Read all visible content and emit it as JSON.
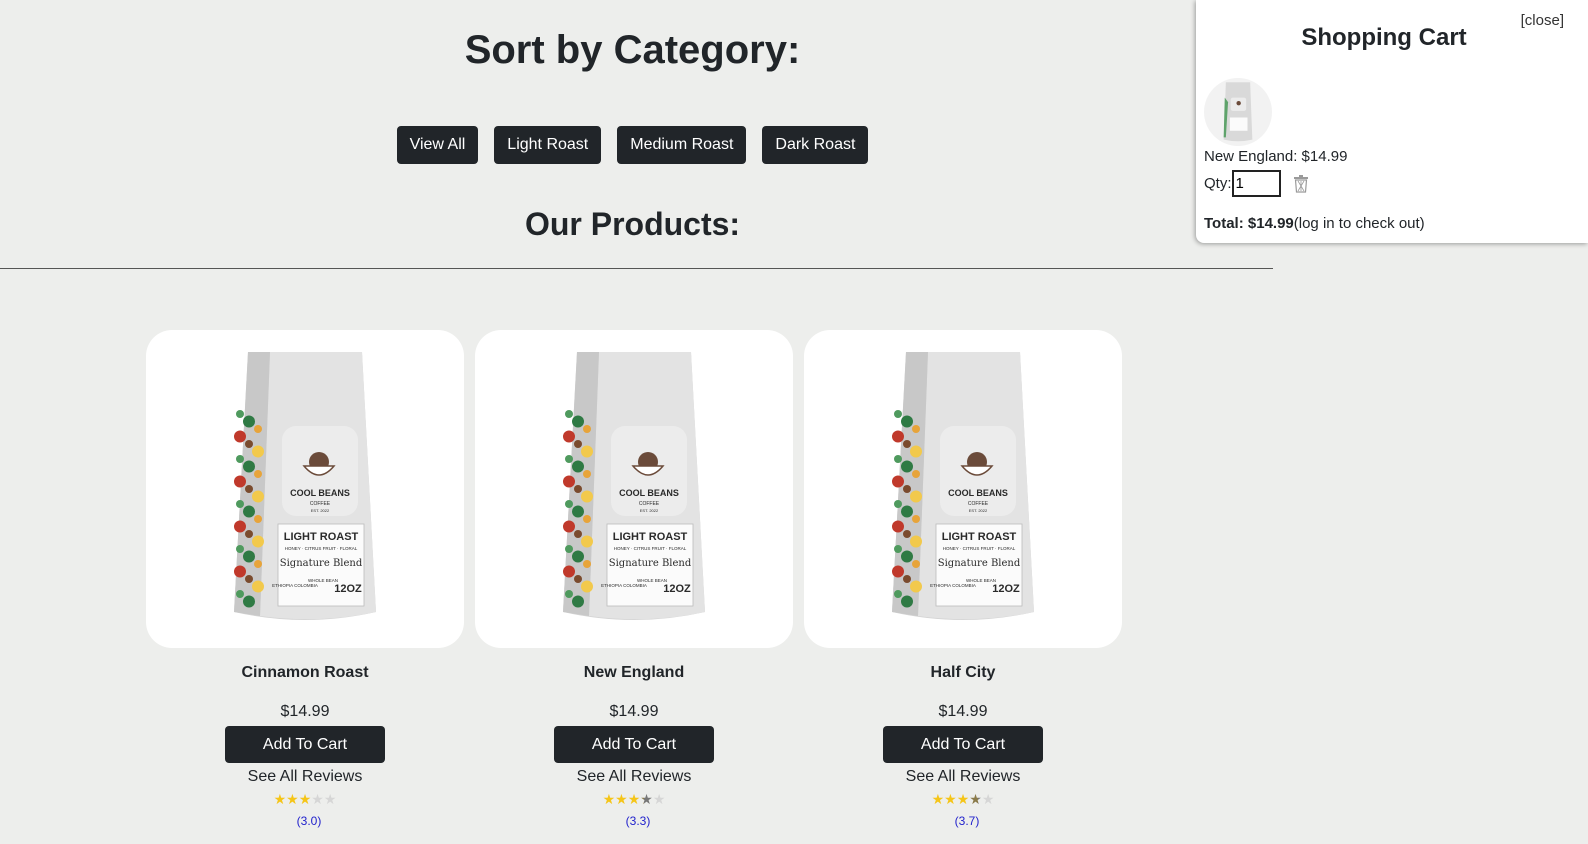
{
  "sort": {
    "heading": "Sort by Category:",
    "categories": [
      "View All",
      "Light Roast",
      "Medium Roast",
      "Dark Roast"
    ]
  },
  "products_heading": "Our Products:",
  "product_bag": {
    "brand": "COOL BEANS",
    "brand_sub": "COFFEE",
    "est": "EST. 2022",
    "roast": "LIGHT ROAST",
    "notes": "HONEY · CITRUS FRUIT · FLORAL",
    "blend": "Signature Blend",
    "origin": "ETHIOPIA COLOMBIA",
    "type": "WHOLE BEAN",
    "weight": "12OZ"
  },
  "products": [
    {
      "name": "Cinnamon Roast",
      "price": "$14.99",
      "add_label": "Add To Cart",
      "reviews_label": "See All Reviews",
      "rating": 3.0,
      "rating_text": "(3.0)"
    },
    {
      "name": "New England",
      "price": "$14.99",
      "add_label": "Add To Cart",
      "reviews_label": "See All Reviews",
      "rating": 3.3,
      "rating_text": "(3.3)"
    },
    {
      "name": "Half City",
      "price": "$14.99",
      "add_label": "Add To Cart",
      "reviews_label": "See All Reviews",
      "rating": 3.7,
      "rating_text": "(3.7)"
    }
  ],
  "cart": {
    "close_label": "[close]",
    "title": "Shopping Cart",
    "item_line": "New England: $14.99",
    "qty_label": "Qty:",
    "qty_value": "1",
    "total_label": "Total: $14.99",
    "total_note": "(log in to check out)"
  },
  "colors": {
    "background": "#edeeec",
    "button": "#212529",
    "star_filled": "#f5c518",
    "star_empty": "#d6d6d6",
    "rating_text": "#2222cc"
  }
}
